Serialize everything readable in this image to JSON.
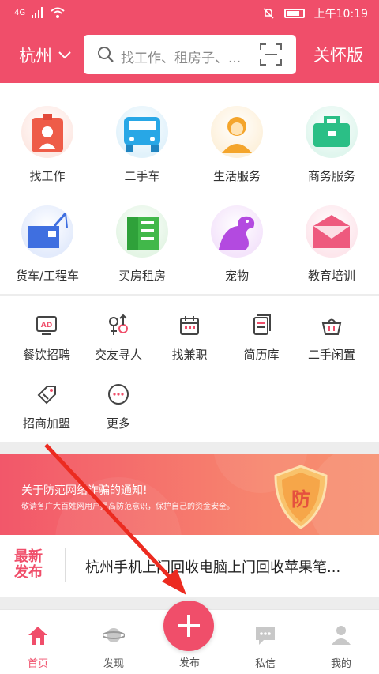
{
  "status": {
    "network": "4G",
    "time": "上午10:19"
  },
  "header": {
    "city": "杭州",
    "search_placeholder": "找工作、租房子、...",
    "care_mode": "关怀版"
  },
  "categories": [
    {
      "label": "找工作",
      "icon": "job-icon",
      "color": "#ee5c48"
    },
    {
      "label": "二手车",
      "icon": "car-icon",
      "color": "#28a7e6"
    },
    {
      "label": "生活服务",
      "icon": "service-person-icon",
      "color": "#f4a52c"
    },
    {
      "label": "商务服务",
      "icon": "briefcase-icon",
      "color": "#2bbf86"
    },
    {
      "label": "货车/工程车",
      "icon": "truck-icon",
      "color": "#3f6fe0"
    },
    {
      "label": "买房租房",
      "icon": "building-icon",
      "color": "#41b84a"
    },
    {
      "label": "宠物",
      "icon": "pet-icon",
      "color": "#b34ae0"
    },
    {
      "label": "教育培训",
      "icon": "education-icon",
      "color": "#ee5a7e"
    }
  ],
  "services": [
    {
      "label": "餐饮招聘",
      "icon": "ad-icon"
    },
    {
      "label": "交友寻人",
      "icon": "gender-icon"
    },
    {
      "label": "找兼职",
      "icon": "calendar-icon"
    },
    {
      "label": "简历库",
      "icon": "resume-icon"
    },
    {
      "label": "二手闲置",
      "icon": "basket-icon"
    },
    {
      "label": "招商加盟",
      "icon": "tag-icon"
    },
    {
      "label": "更多",
      "icon": "more-icon"
    }
  ],
  "banner": {
    "title": "关于防范网络诈骗的通知!",
    "subtitle": "敬请各广大百姓网用户提高防范意识，保护自己的资金安全。",
    "shield_text": "防"
  },
  "news": {
    "tag_line1": "最新",
    "tag_line2": "发布",
    "text": "杭州手机上门回收电脑上门回收苹果笔..."
  },
  "tabbar": {
    "home": "首页",
    "discover": "发现",
    "publish": "发布",
    "messages": "私信",
    "mine": "我的",
    "active_color": "#f04e6a"
  }
}
